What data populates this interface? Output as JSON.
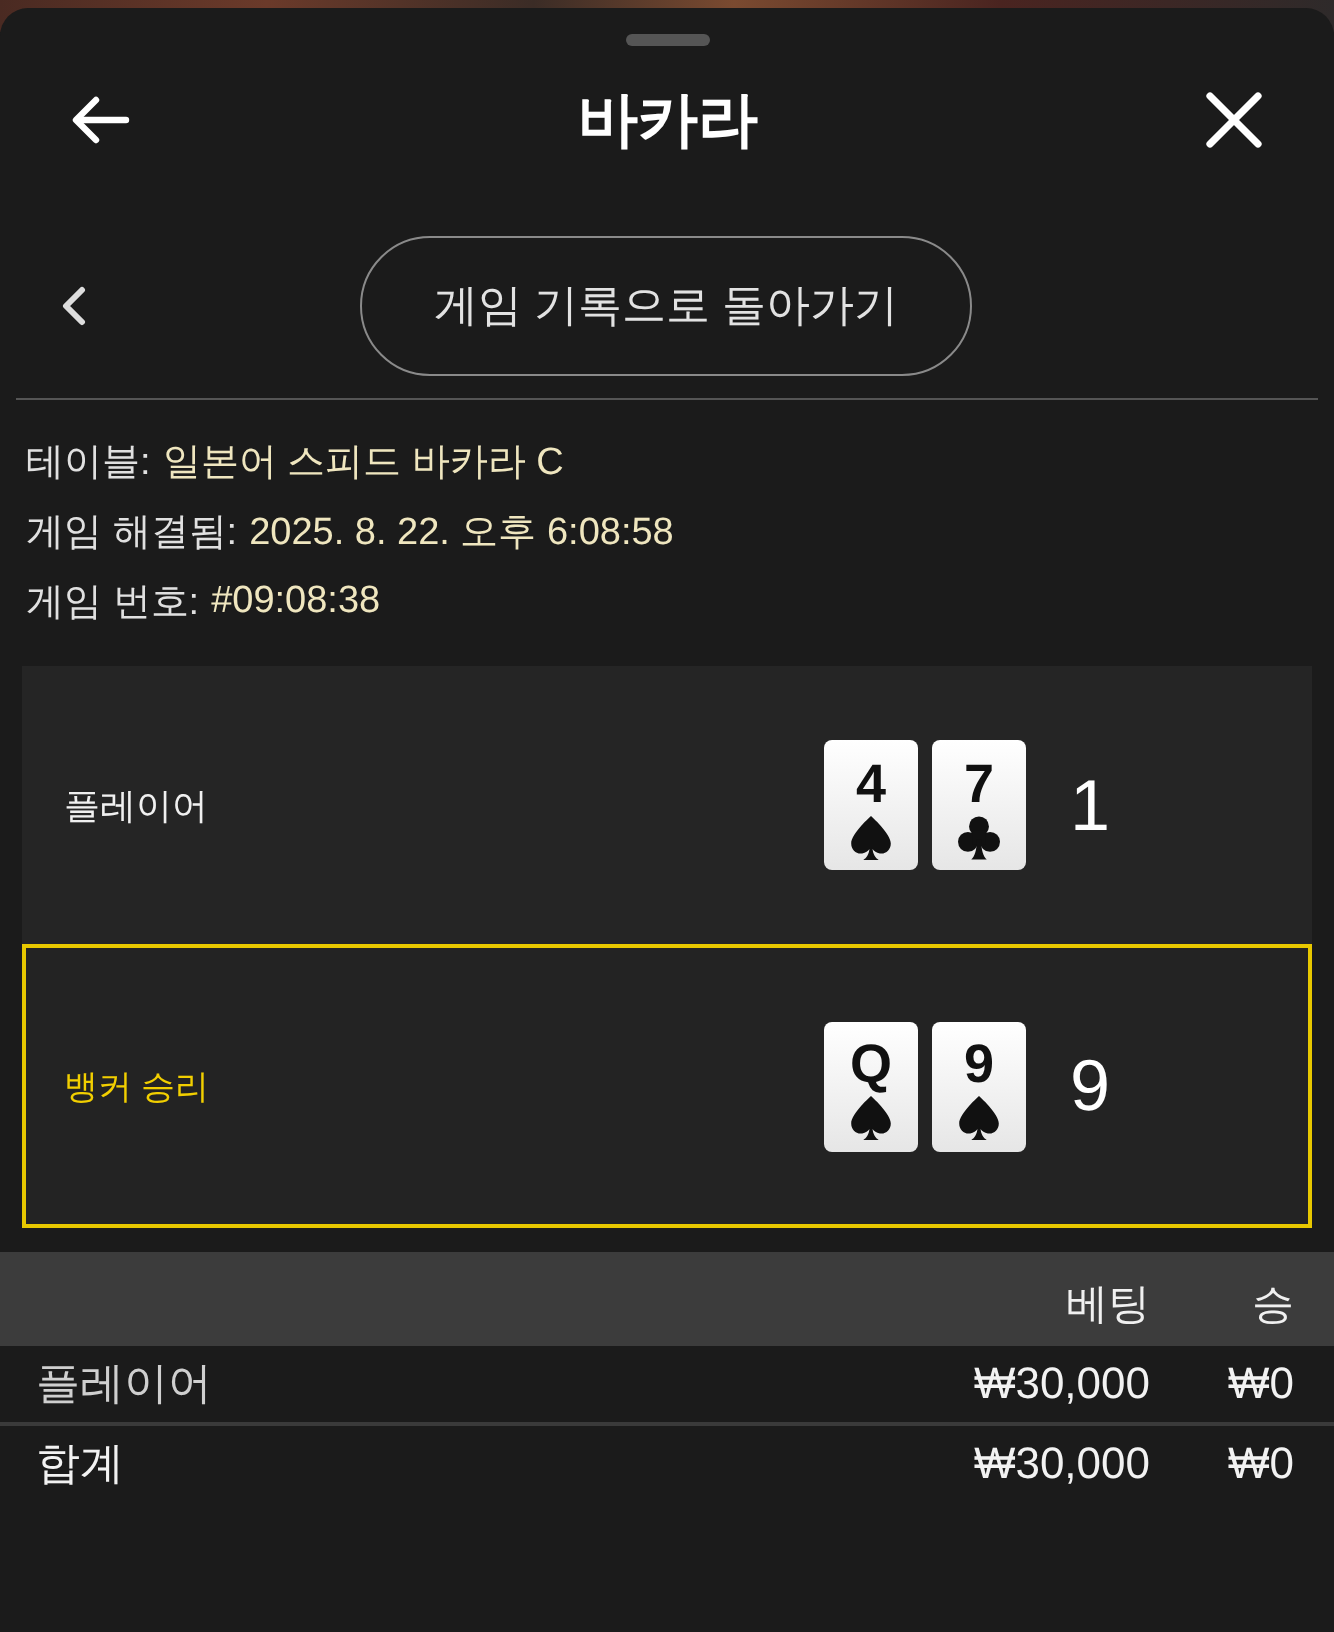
{
  "sheet": {
    "title": "바카라"
  },
  "nav": {
    "back_button": "게임 기록으로 돌아가기"
  },
  "info": [
    {
      "label": "테이블:",
      "value": "일본어 스피드 바카라 C"
    },
    {
      "label": "게임 해결됨:",
      "value": "2025. 8. 22. 오후 6:08:58"
    },
    {
      "label": "게임 번호:",
      "value": "#09:08:38"
    }
  ],
  "hands": [
    {
      "name": "플레이어",
      "winner": false,
      "cards": [
        {
          "rank": "4",
          "kind": "spade"
        },
        {
          "rank": "7",
          "kind": "club"
        }
      ],
      "score": "1"
    },
    {
      "name": "뱅커 승리",
      "winner": true,
      "cards": [
        {
          "rank": "Q",
          "kind": "spade"
        },
        {
          "rank": "9",
          "kind": "spade"
        }
      ],
      "score": "9"
    }
  ],
  "bets": {
    "columns": [
      "베팅",
      "승"
    ],
    "rows": [
      {
        "name": "플레이어",
        "bet": "₩30,000",
        "win": "₩0"
      }
    ],
    "total": {
      "name": "합계",
      "bet": "₩30,000",
      "win": "₩0"
    }
  }
}
